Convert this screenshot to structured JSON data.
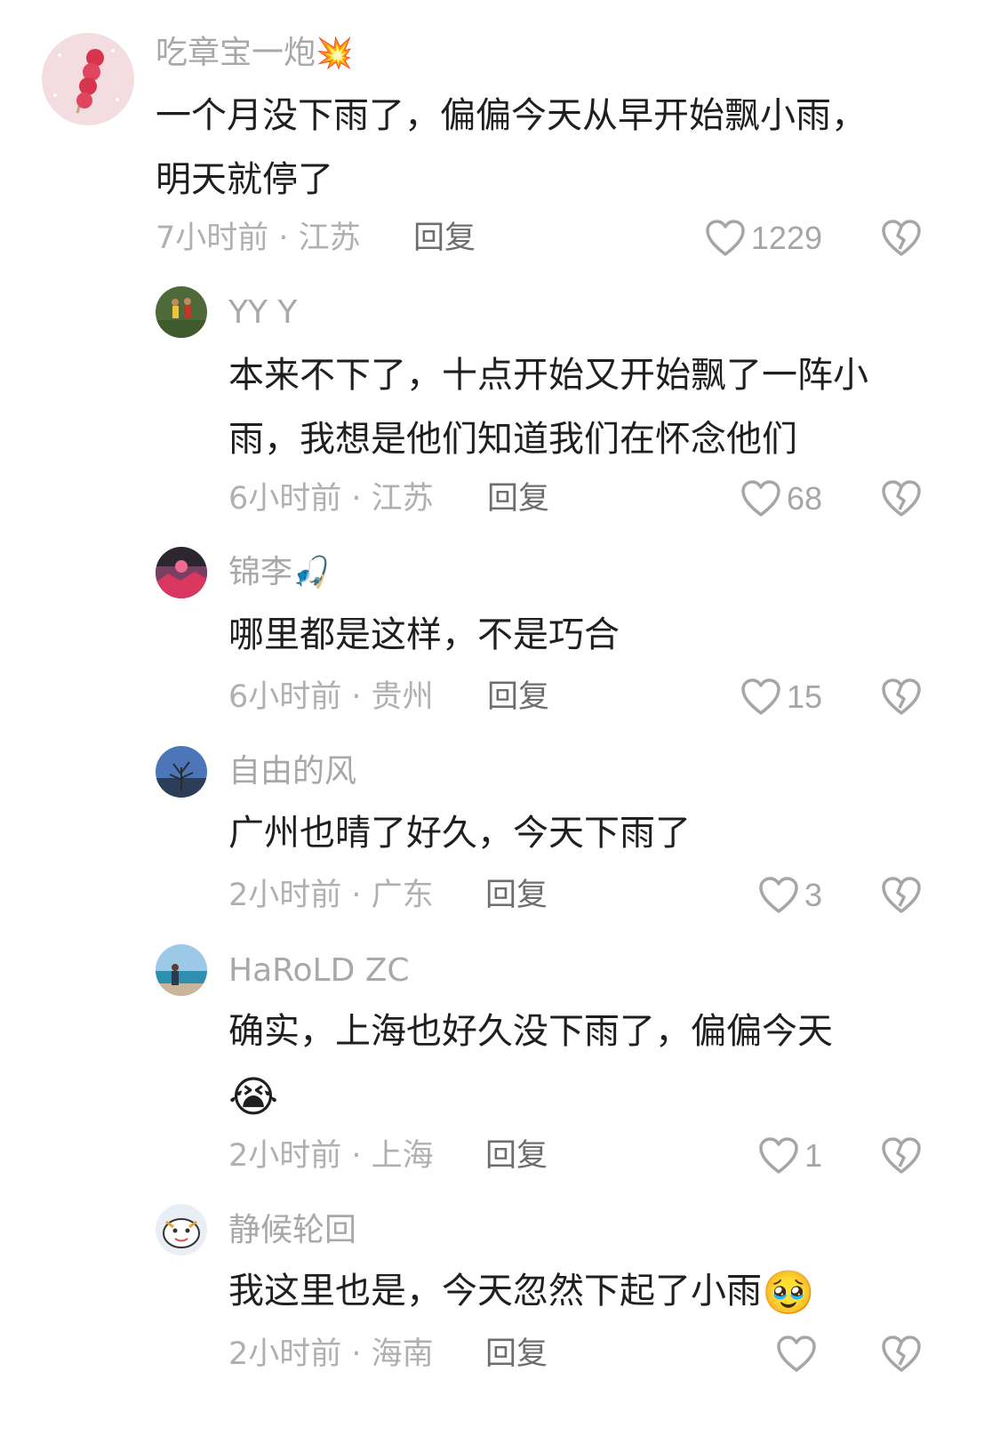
{
  "comments": [
    {
      "username": "吃章宝一炮",
      "username_emoji": "💥",
      "lines": [
        "一个月没下雨了，偏偏今天从早开始飘小雨，",
        "明天就停了"
      ],
      "time_location": "7小时前 · 江苏",
      "reply_label": "回复",
      "likes": "1229",
      "avatar": "candied-hawthorn-avatar"
    },
    {
      "username": "YY Y",
      "lines": [
        "本来不下了，十点开始又开始飘了一阵小",
        "雨，我想是他们知道我们在怀念他们"
      ],
      "time_location": "6小时前 · 江苏",
      "reply_label": "回复",
      "likes": "68",
      "avatar": "soccer-players-avatar"
    },
    {
      "username": "锦李",
      "username_emoji": "🎣",
      "lines": [
        "哪里都是这样，不是巧合"
      ],
      "time_location": "6小时前 · 贵州",
      "reply_label": "回复",
      "likes": "15",
      "avatar": "sunset-avatar"
    },
    {
      "username": "自由的风",
      "lines": [
        "广州也晴了好久，今天下雨了"
      ],
      "time_location": "2小时前 · 广东",
      "reply_label": "回复",
      "likes": "3",
      "avatar": "tree-sky-avatar"
    },
    {
      "username": "HaRoLD ZC",
      "lines": [
        "确实，上海也好久没下雨了，偏偏今天"
      ],
      "content_emoji": "😭",
      "time_location": "2小时前 · 上海",
      "reply_label": "回复",
      "likes": "1",
      "avatar": "beach-person-avatar"
    },
    {
      "username": "静候轮回",
      "lines": [
        "我这里也是，今天忽然下起了小雨"
      ],
      "content_inline_emoji": "🥹",
      "time_location": "2小时前 · 海南",
      "reply_label": "回复",
      "likes": "",
      "avatar": "cartoon-avatar"
    }
  ],
  "colors": {
    "username": "#a8a8a8",
    "text": "#1f1f1f",
    "meta": "#b0b0b0",
    "reply": "#6e6e6e",
    "icon": "#a6a6a6"
  }
}
